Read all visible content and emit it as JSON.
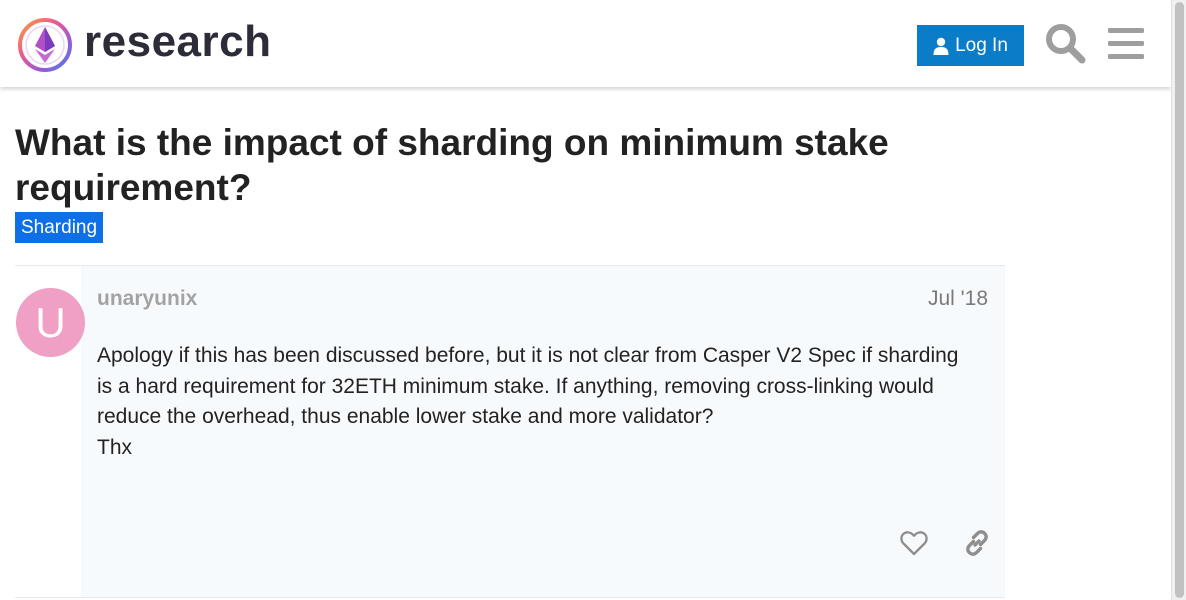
{
  "header": {
    "brand": "research",
    "login_label": "Log In",
    "accent_color": "#0b7cc7"
  },
  "topic": {
    "title": "What is the impact of sharding on minimum stake requirement?",
    "category": "Sharding",
    "category_color": "#0f6fe6"
  },
  "post": {
    "avatar_letter": "U",
    "avatar_color": "#efa0c4",
    "username": "unaryunix",
    "date": "Jul '18",
    "paragraphs": [
      "Apology if this has been discussed before, but it is not clear from Casper V2 Spec if sharding is a hard requirement for 32ETH minimum stake. If anything, removing cross-linking would reduce the overhead, thus enable lower stake and more validator?",
      "Thx"
    ]
  },
  "icons": {
    "logo": "ethereum-research-logo",
    "login": "user-icon",
    "search": "search-icon",
    "menu": "hamburger-menu-icon",
    "like": "heart-icon",
    "share": "link-icon"
  }
}
